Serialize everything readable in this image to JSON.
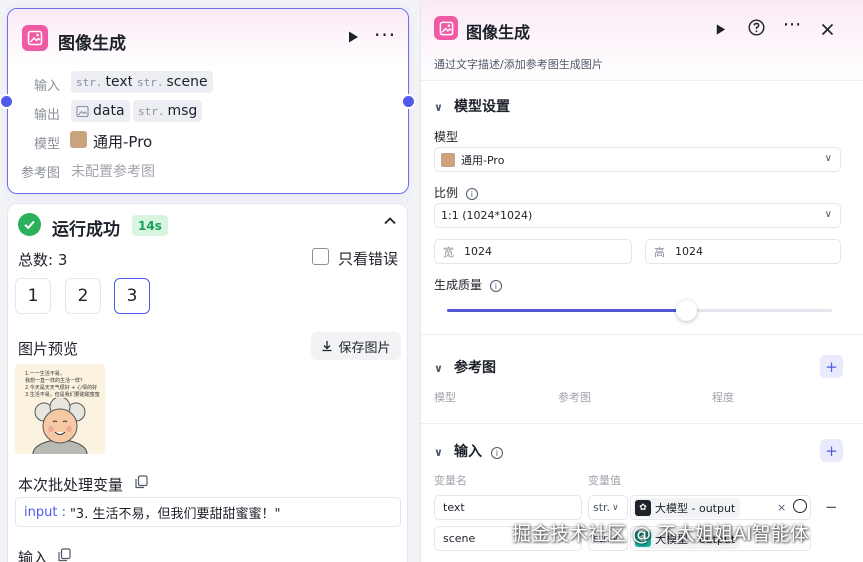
{
  "node": {
    "title": "图像生成",
    "input_label": "输入",
    "output_label": "输出",
    "model_label": "模型",
    "ref_label": "参考图",
    "inputs": [
      {
        "prefix": "str.",
        "name": "text"
      },
      {
        "prefix": "str.",
        "name": "scene"
      }
    ],
    "outputs": [
      {
        "prefix": "img",
        "name": "data"
      },
      {
        "prefix": "str.",
        "name": "msg"
      }
    ],
    "model_value": "通用-Pro",
    "ref_value": "未配置参考图"
  },
  "run": {
    "status": "运行成功",
    "duration": "14s",
    "total": "总数: 3",
    "only_errors": "只看错误",
    "pages": [
      "1",
      "2",
      "3"
    ],
    "active_page": "3",
    "preview_label": "图片预览",
    "save_label": "保存图片",
    "batch_label": "本次批处理变量",
    "batch_key": "input :",
    "batch_value": "\"3. 生活不易，但我们要甜甜蜜蜜！\"",
    "input_section": "输入",
    "preview_lines": [
      "1.一一生活不易，",
      "我想一直一样的生活一样？",
      "2.今天是天天气很好 + 心情的好",
      "3.生活不易，但是我们要甜甜蜜蜜"
    ]
  },
  "panel": {
    "title": "图像生成",
    "description": "通过文字描述/添加参考图生成图片",
    "model_section": "模型设置",
    "model_label": "模型",
    "model_value": "通用-Pro",
    "ratio_label": "比例",
    "ratio_value": "1:1 (1024*1024)",
    "width_prefix": "宽",
    "width_value": "1024",
    "height_prefix": "高",
    "height_value": "1024",
    "quality_label": "生成质量",
    "quality_level": 0.62,
    "ref_section": "参考图",
    "ref_columns": [
      "模型",
      "参考图",
      "程度"
    ],
    "input_section": "输入",
    "var_name_header": "变量名",
    "var_value_header": "变量值",
    "rows": [
      {
        "name": "text",
        "type": "str.",
        "ref": "大模型 - output"
      },
      {
        "name": "scene",
        "type": "str.",
        "ref": "大模型 - output"
      }
    ]
  },
  "watermark": "掘金技术社区 @ 不太姐姐AI智能体",
  "colors": {
    "accent": "#4f5be8",
    "brand_pink": "#f05aa5",
    "success": "#2bb15a"
  }
}
